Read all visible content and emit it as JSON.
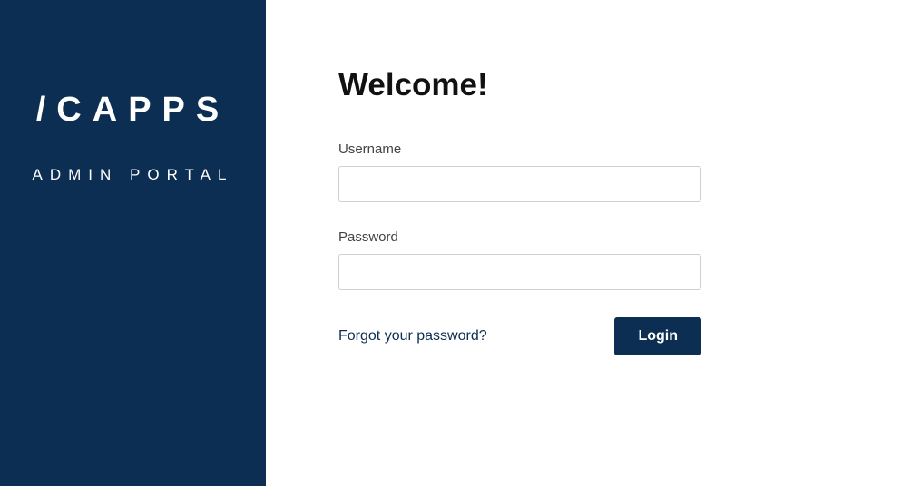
{
  "sidebar": {
    "logo_text": "/CAPPS",
    "subtitle": "ADMIN PORTAL"
  },
  "main": {
    "title": "Welcome!",
    "username_label": "Username",
    "password_label": "Password",
    "forgot_password_text": "Forgot your password?",
    "login_button_label": "Login"
  }
}
